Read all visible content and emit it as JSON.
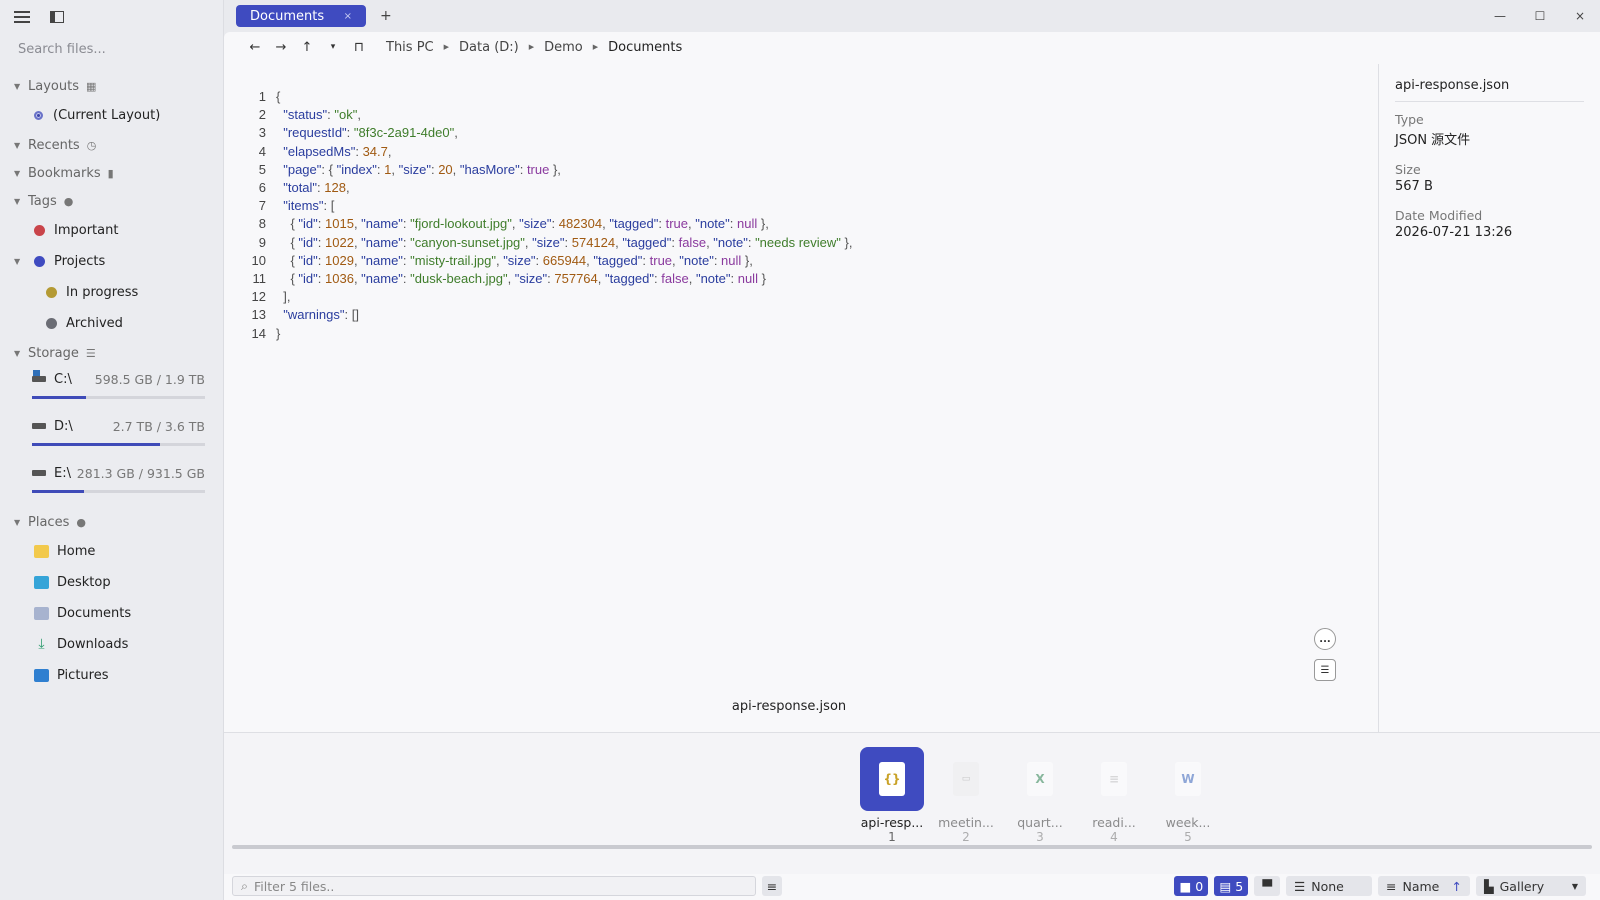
{
  "sidebar": {
    "search_placeholder": "Search files...",
    "layouts": {
      "label": "Layouts",
      "items": [
        "(Current Layout)"
      ]
    },
    "recents": {
      "label": "Recents"
    },
    "bookmarks": {
      "label": "Bookmarks"
    },
    "tags": {
      "label": "Tags",
      "items": [
        {
          "label": "Important",
          "color": "#c9444a"
        },
        {
          "label": "Projects",
          "color": "#3f4bc0"
        },
        {
          "label": "In progress",
          "color": "#b49a34"
        },
        {
          "label": "Archived",
          "color": "#6b6d75"
        }
      ]
    },
    "storage": {
      "label": "Storage",
      "drives": [
        {
          "name": "C:\\",
          "capacity": "598.5 GB / 1.9 TB",
          "used_fraction": 0.31
        },
        {
          "name": "D:\\",
          "capacity": "2.7 TB / 3.6 TB",
          "used_fraction": 0.74
        },
        {
          "name": "E:\\",
          "capacity": "281.3 GB / 931.5 GB",
          "used_fraction": 0.3
        }
      ]
    },
    "places": {
      "label": "Places",
      "items": [
        "Home",
        "Desktop",
        "Documents",
        "Downloads",
        "Pictures"
      ]
    }
  },
  "tabs": {
    "active_label": "Documents",
    "close": "×",
    "new": "+"
  },
  "window": {
    "minimize": "—",
    "maximize": "☐",
    "close": "×"
  },
  "nav": {
    "back": "←",
    "forward": "→",
    "up": "↑",
    "history": "▾",
    "breadcrumb": [
      "This PC",
      "Data (D:)",
      "Demo",
      "Documents"
    ]
  },
  "editor": {
    "line_numbers": [
      "1",
      "2",
      "3",
      "4",
      "5",
      "6",
      "7",
      "8",
      "9",
      "10",
      "11",
      "12",
      "13",
      "14"
    ]
  },
  "details": {
    "file_name": "api-response.json",
    "type_label": "Type",
    "type_value": "JSON 源文件",
    "size_label": "Size",
    "size_value": "567 B",
    "modified_label": "Date Modified",
    "modified_value": "2026-07-21 13:26"
  },
  "preview": {
    "file_name": "api-response.json",
    "more_button": "...",
    "info_button": "☰"
  },
  "gallery": {
    "items": [
      {
        "name": "api-resp...",
        "index": "1"
      },
      {
        "name": "meetin...",
        "index": "2"
      },
      {
        "name": "quart...",
        "index": "3"
      },
      {
        "name": "readi...",
        "index": "4"
      },
      {
        "name": "week...",
        "index": "5"
      }
    ]
  },
  "status": {
    "filter_placeholder": "Filter 5 files..",
    "folder_count": "0",
    "file_count": "5",
    "group_label": "None",
    "sort_label": "Name",
    "sort_dir": "↑",
    "view_label": "Gallery"
  },
  "colors": {
    "accent": "#3f4bc0",
    "json_key": "#2a3d9e",
    "json_string": "#3f7d2b",
    "json_number": "#a05a12",
    "json_literal": "#8a3a9e"
  }
}
